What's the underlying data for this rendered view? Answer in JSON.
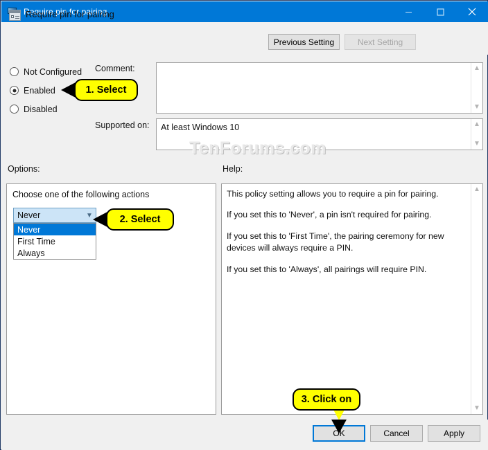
{
  "window": {
    "title": "Require pin for pairing",
    "title_icon": "monitor-icon",
    "minimize_label": "Minimize",
    "maximize_label": "Maximize",
    "close_label": "Close",
    "border_color": "#1f3864",
    "titlebar_color": "#0078d7"
  },
  "header": {
    "policy_title": "Require pin for pairing",
    "policy_icon": "policy-setting-icon",
    "previous_setting": "Previous Setting",
    "next_setting": "Next Setting",
    "next_setting_disabled": true
  },
  "state": {
    "options": [
      {
        "label": "Not Configured",
        "selected": false
      },
      {
        "label": "Enabled",
        "selected": true
      },
      {
        "label": "Disabled",
        "selected": false
      }
    ]
  },
  "comment": {
    "label": "Comment:",
    "value": ""
  },
  "supported": {
    "label": "Supported on:",
    "value": "At least Windows 10"
  },
  "watermark": "TenForums.com",
  "options_section": {
    "label": "Options:",
    "caption": "Choose one of the following actions",
    "dropdown": {
      "value": "Never",
      "open": true,
      "items": [
        {
          "label": "Never",
          "highlighted": true
        },
        {
          "label": "First Time",
          "highlighted": false
        },
        {
          "label": "Always",
          "highlighted": false
        }
      ],
      "highlight_color": "#0078d7",
      "field_color": "#cce4f7"
    }
  },
  "help_section": {
    "label": "Help:",
    "paragraphs": [
      "This policy setting allows you to require a pin for pairing.",
      "If you set this to 'Never', a pin isn't required for pairing.",
      "If you set this to 'First Time', the pairing ceremony for new devices will always require a PIN.",
      "If you set this to 'Always', all pairings will require PIN."
    ]
  },
  "footer": {
    "ok": "OK",
    "cancel": "Cancel",
    "apply": "Apply",
    "focus_color": "#0078d7"
  },
  "callouts": [
    {
      "text": "1. Select"
    },
    {
      "text": "2. Select"
    },
    {
      "text": "3. Click on"
    }
  ]
}
